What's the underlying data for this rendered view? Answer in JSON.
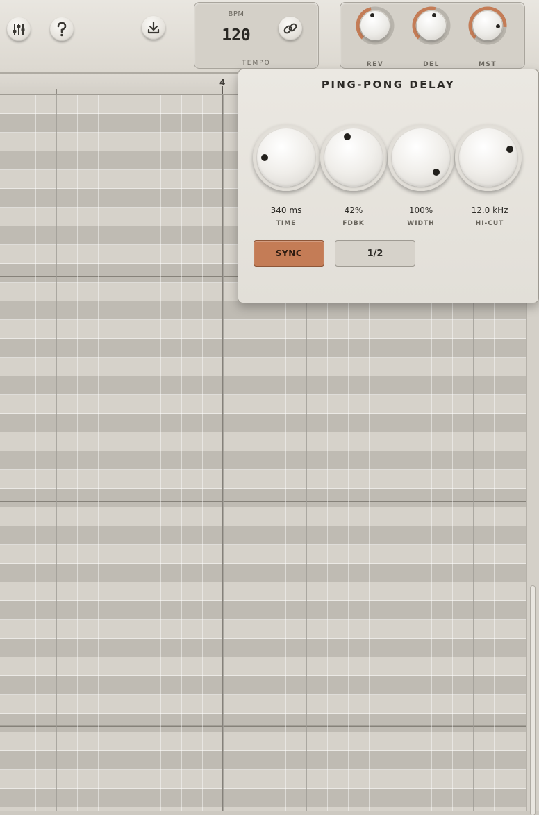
{
  "toolbar": {
    "tempo": {
      "top_label": "BPM",
      "value": "120",
      "bottom_label": "TEMPO"
    },
    "sends": [
      {
        "label": "REV",
        "level": 0.45
      },
      {
        "label": "DEL",
        "level": 0.55
      },
      {
        "label": "MST",
        "level": 0.85
      }
    ],
    "icons": [
      "mixer-sliders-icon",
      "help-icon",
      "download-icon",
      "link-icon"
    ]
  },
  "ruler": {
    "bar_label": "4"
  },
  "delay": {
    "title": "PING-PONG DELAY",
    "knobs": [
      {
        "value": "340 ms",
        "label": "TIME"
      },
      {
        "value": "42%",
        "label": "FDBK"
      },
      {
        "value": "100%",
        "label": "WIDTH"
      },
      {
        "value": "12.0 kHz",
        "label": "HI-CUT"
      }
    ],
    "sync_label": "SYNC",
    "division_label": "1/2"
  },
  "colors": {
    "accent": "#c47c56",
    "background": "#cdc9c1"
  }
}
